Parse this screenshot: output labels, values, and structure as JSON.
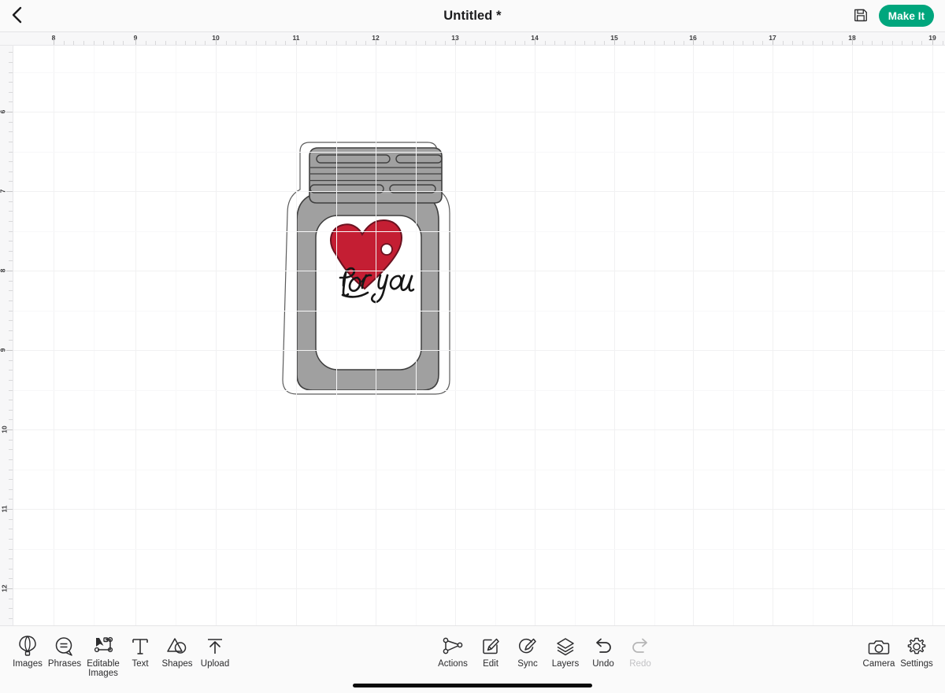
{
  "app": {
    "name": "Cricut Design Space Canvas",
    "accent_color": "#00a67d",
    "canvas_background": "#ffffff",
    "chrome_background": "#fafafa"
  },
  "topbar": {
    "back_icon": "chevron-left-icon",
    "title": "Untitled *",
    "save_icon": "floppy-disk-save-icon",
    "make_it_label": "Make It"
  },
  "rulers": {
    "units": "in",
    "top_labels": [
      "8",
      "9",
      "10",
      "11",
      "12",
      "13",
      "14",
      "15",
      "16",
      "17",
      "18",
      "19"
    ],
    "top_positions": [
      68,
      172,
      274,
      376,
      477,
      578,
      679,
      780,
      880,
      981,
      1082,
      1184
    ],
    "left_labels": [
      "6",
      "7",
      "8",
      "9",
      "10",
      "11",
      "12"
    ],
    "left_positions": [
      142,
      243,
      344,
      445,
      546,
      647,
      748
    ]
  },
  "canvas": {
    "watermark": "",
    "grid_major_spacing_px": 101,
    "grid_color": "#f1f1f2",
    "artwork": {
      "name": "mason-jar-with-for-you-heart-tag",
      "layers": [
        {
          "name": "offset-outline-layer",
          "fill": "#ffffff",
          "stroke": "#555555"
        },
        {
          "name": "jar-body-layer",
          "fill": "#a0a0a0",
          "stroke": "#444444"
        },
        {
          "name": "jar-lid-layer",
          "fill": "#a0a0a0",
          "stroke": "#444444"
        },
        {
          "name": "jar-label-panel-layer",
          "fill": "#ffffff",
          "stroke": "#444444"
        },
        {
          "name": "heart-tag-layer",
          "fill": "#c41e33",
          "stroke": "#6b1220"
        },
        {
          "name": "for-you-script-layer",
          "fill": "#1a1a1a"
        }
      ],
      "heart_tag_text": "for you"
    }
  },
  "bottombar": {
    "left_tools": [
      {
        "label": "Images",
        "icon": "hot-air-balloon-icon",
        "name": "images",
        "disabled": false
      },
      {
        "label": "Phrases",
        "icon": "speech-bubble-icon",
        "name": "phrases",
        "disabled": false
      },
      {
        "label": "Editable\nImages",
        "icon": "node-path-edit-icon",
        "name": "editable-images",
        "disabled": false
      },
      {
        "label": "Text",
        "icon": "text-t-icon",
        "name": "text",
        "disabled": false
      },
      {
        "label": "Shapes",
        "icon": "shapes-icon",
        "name": "shapes",
        "disabled": false
      },
      {
        "label": "Upload",
        "icon": "upload-arrow-icon",
        "name": "upload",
        "disabled": false
      }
    ],
    "center_tools": [
      {
        "label": "Actions",
        "icon": "nodes-triangle-icon",
        "name": "actions",
        "disabled": false
      },
      {
        "label": "Edit",
        "icon": "pencil-square-icon",
        "name": "edit",
        "disabled": false
      },
      {
        "label": "Sync",
        "icon": "sync-pencil-icon",
        "name": "sync",
        "disabled": false
      },
      {
        "label": "Layers",
        "icon": "layers-stack-icon",
        "name": "layers",
        "disabled": false
      },
      {
        "label": "Undo",
        "icon": "undo-arrow-icon",
        "name": "undo",
        "disabled": false
      },
      {
        "label": "Redo",
        "icon": "redo-arrow-icon",
        "name": "redo",
        "disabled": true
      }
    ],
    "right_tools": [
      {
        "label": "Camera",
        "icon": "camera-icon",
        "name": "camera",
        "disabled": false
      },
      {
        "label": "Settings",
        "icon": "gear-icon",
        "name": "settings",
        "disabled": false
      }
    ]
  }
}
